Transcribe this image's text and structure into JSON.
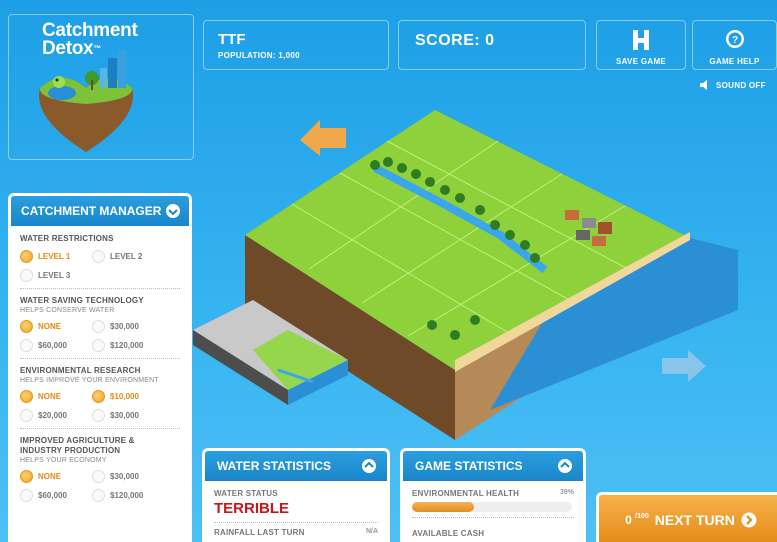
{
  "logo": {
    "title_line1": "Catchment",
    "title_line2": "Detox",
    "trademark": "™"
  },
  "city": {
    "name": "TTF",
    "population": "POPULATION: 1,000"
  },
  "score": {
    "label": "SCORE: 0"
  },
  "toolbar": {
    "save_label": "SAVE GAME",
    "help_label": "GAME HELP",
    "sound_label": "SOUND OFF"
  },
  "catchment_manager": {
    "title": "CATCHMENT MANAGER",
    "sections": [
      {
        "title": "WATER RESTRICTIONS",
        "subtitle": "",
        "options": [
          {
            "label": "LEVEL 1",
            "selected": true
          },
          {
            "label": "LEVEL 2",
            "selected": false
          },
          {
            "label": "LEVEL 3",
            "selected": false
          }
        ]
      },
      {
        "title": "WATER SAVING TECHNOLOGY",
        "subtitle": "HELPS CONSERVE WATER",
        "options": [
          {
            "label": "NONE",
            "selected": true
          },
          {
            "label": "$30,000",
            "selected": false
          },
          {
            "label": "$60,000",
            "selected": false
          },
          {
            "label": "$120,000",
            "selected": false
          }
        ]
      },
      {
        "title": "ENVIRONMENTAL RESEARCH",
        "subtitle": "HELPS IMPROVE YOUR ENVIRONMENT",
        "options": [
          {
            "label": "NONE",
            "selected": true
          },
          {
            "label": "$10,000",
            "selected": true
          },
          {
            "label": "$20,000",
            "selected": false
          },
          {
            "label": "$30,000",
            "selected": false
          }
        ]
      },
      {
        "title_line1": "IMPROVED AGRICULTURE &",
        "title_line2": "INDUSTRY PRODUCTION",
        "subtitle": "HELPS YOUR ECONOMY",
        "options": [
          {
            "label": "NONE",
            "selected": true
          },
          {
            "label": "$30,000",
            "selected": false
          },
          {
            "label": "$60,000",
            "selected": false
          },
          {
            "label": "$120,000",
            "selected": false
          }
        ]
      }
    ]
  },
  "water_statistics": {
    "title": "WATER STATISTICS",
    "status_label": "WATER STATUS",
    "status_value": "TERRIBLE",
    "rainfall_label": "RAINFALL LAST TURN",
    "rainfall_value": "N/A"
  },
  "game_statistics": {
    "title": "GAME STATISTICS",
    "env_health_label": "ENVIRONMENTAL HEALTH",
    "env_health_value": "39%",
    "env_health_fraction": 0.39,
    "cash_label": "AVAILABLE CASH"
  },
  "next_turn": {
    "count": "0",
    "max": "/100",
    "label": "NEXT TURN"
  },
  "colors": {
    "sky": "#2aa8ec",
    "accent_orange": "#e98b1f",
    "status_red": "#c4161c",
    "grass": "#8ed13a"
  }
}
